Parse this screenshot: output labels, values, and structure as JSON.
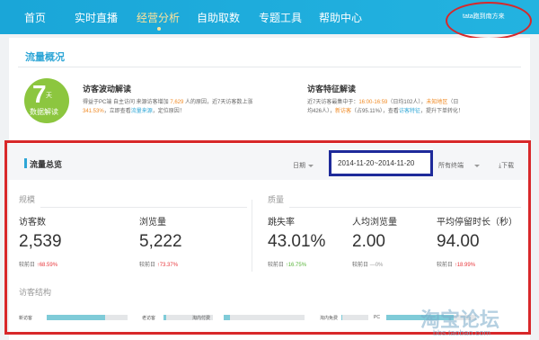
{
  "nav": {
    "items": [
      "首页",
      "实时直播",
      "经营分析",
      "自助取数",
      "专题工具",
      "帮助中心"
    ],
    "user": "tata跑到南方来"
  },
  "overview": {
    "title": "流量概况",
    "badge": {
      "number": "7",
      "unit": "天",
      "label": "数据解读"
    },
    "fluctuation": {
      "title": "访客波动解读",
      "line1_pre": "得益于PC端 自主访问 来源访客增加",
      "line1_hl": "7,629",
      "line1_post": "人的原因，近7天访客数上涨",
      "line2_hl": "341.53%",
      "line2_pre": "，立即查看",
      "line2_link": "流量来源",
      "line2_post": "，定位原因！"
    },
    "features": {
      "title": "访客特征解读",
      "line1_pre": "近7天访客最集中于：",
      "line1_time": "16:00-16:59",
      "line1_mid": "（日均102人），",
      "line1_region": "未知地区",
      "line1_post": "（日",
      "line2_pre": "均426人），",
      "line2_hl": "新访客",
      "line2_mid": "（占95.11%），查看",
      "line2_link": "访客特征",
      "line2_post": "，提升下单转化！"
    }
  },
  "traffic": {
    "title": "流量总览",
    "period_label": "日期",
    "date_range": "2014-11-20~2014-11-20",
    "terminal": "所有终端",
    "download": "下载",
    "group_scale": "规模",
    "group_quality": "质量",
    "compare_label": "较前日",
    "metrics": [
      {
        "label": "访客数",
        "value": "2,539",
        "change": "68.59%",
        "trend": "up-red"
      },
      {
        "label": "浏览量",
        "value": "5,222",
        "change": "73.37%",
        "trend": "up-red"
      },
      {
        "label": "跳失率",
        "value": "43.01%",
        "change": "16.75%",
        "trend": "up-green"
      },
      {
        "label": "人均浏览量",
        "value": "2.00",
        "change": "0%",
        "trend": "flat"
      },
      {
        "label": "平均停留时长（秒）",
        "value": "94.00",
        "change": "18.99%",
        "trend": "up-red"
      }
    ],
    "structure_title": "访客结构",
    "bars": [
      {
        "label": "新访客",
        "value": 0.72
      },
      {
        "label": "老访客",
        "value": 0.05
      },
      {
        "label": "淘内付费",
        "value": 0.08
      },
      {
        "label": "淘内免费",
        "value": 0.02
      },
      {
        "label": "PC",
        "value": 0.75
      }
    ]
  },
  "watermark": {
    "main": "淘宝论坛",
    "sub": "bbs.taobao.com"
  },
  "colors": {
    "nav": "#1aa6d8",
    "accent": "#2ea6d6",
    "highlight_box": "#d8282a",
    "date_box": "#1e2a9a",
    "badge": "#8cc63f"
  }
}
